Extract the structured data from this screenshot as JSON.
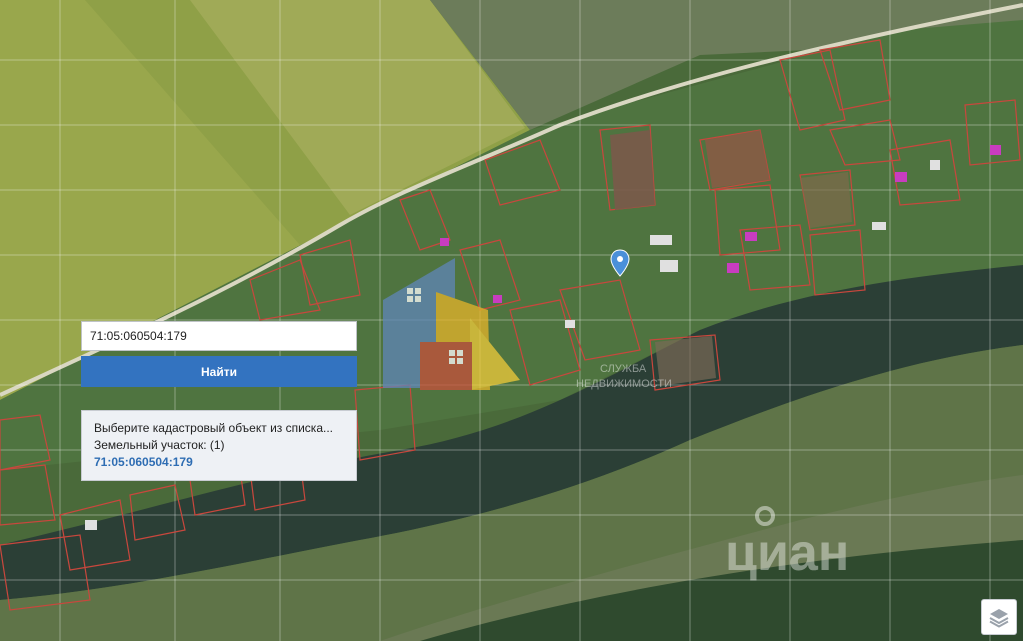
{
  "search": {
    "value": "71:05:060504:179",
    "button_label": "Найти"
  },
  "results": {
    "prompt": "Выберите кадастровый объект из списка...",
    "category": "Земельный участок: (1)",
    "items": [
      "71:05:060504:179"
    ]
  },
  "watermark": {
    "line1": "СЛУЖБА",
    "line2": "НЕДВИЖИМОСТИ",
    "cian": "циан"
  },
  "icons": {
    "marker": "location-pin-icon",
    "layers": "layers-icon"
  },
  "colors": {
    "field_green": "#8c9d43",
    "river": "#2b3f36",
    "parcel_outline": "#c9473d",
    "button_blue": "#3373c0",
    "link_blue": "#2e6db3",
    "marker_blue": "#4a90d9"
  }
}
